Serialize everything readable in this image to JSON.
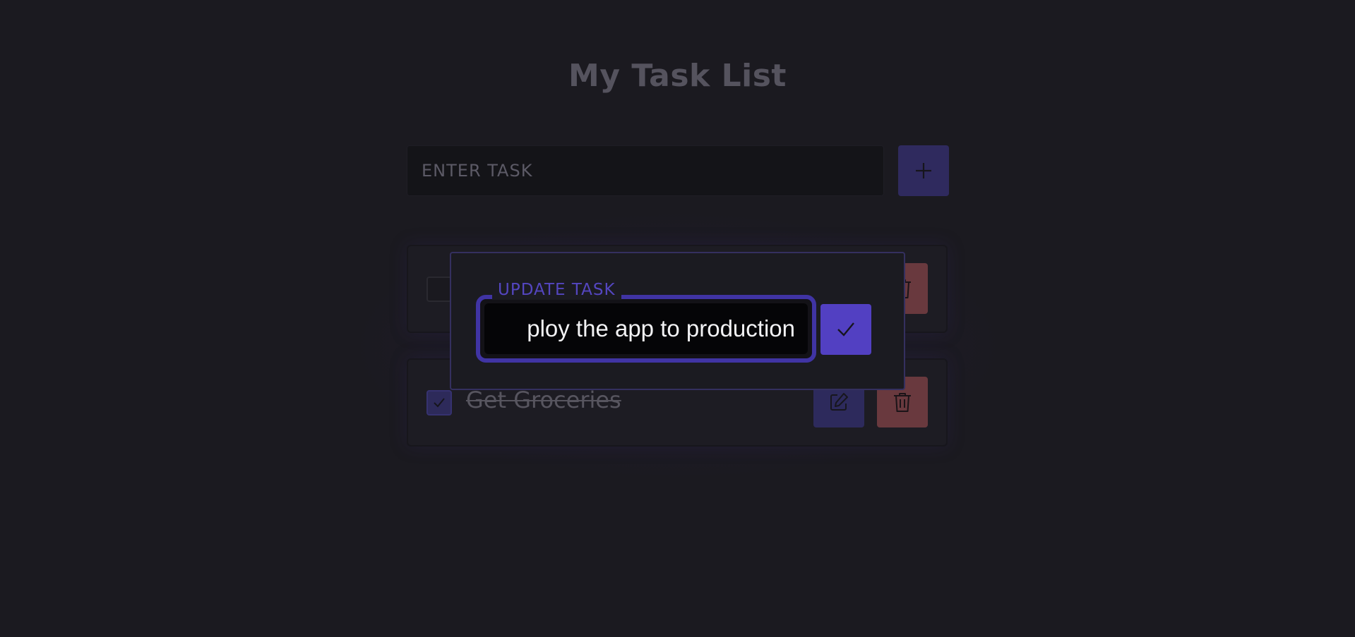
{
  "page": {
    "title": "My Task List"
  },
  "add_task": {
    "placeholder": "ENTER TASK",
    "button_icon": "plus-icon"
  },
  "tasks": [
    {
      "text": "",
      "completed": false,
      "edit_icon": "pencil-square-icon",
      "delete_icon": "trash-icon"
    },
    {
      "text": "Get Groceries",
      "completed": true,
      "edit_icon": "pencil-square-icon",
      "delete_icon": "trash-icon"
    }
  ],
  "update_modal": {
    "legend": "UPDATE TASK",
    "value": "ploy the app to production",
    "confirm_icon": "check-icon"
  },
  "colors": {
    "background": "#1b1a20",
    "accent": "#5240c2",
    "accent_border": "#4034a4",
    "danger": "#69393e",
    "text_muted": "#55535e"
  }
}
